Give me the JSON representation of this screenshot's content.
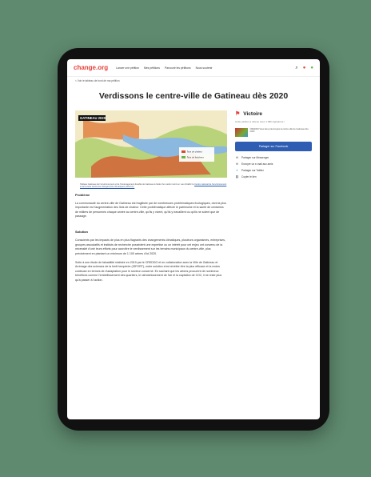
{
  "header": {
    "logo": "change.org",
    "nav": [
      "Lancer une pétition",
      "Mes pétitions",
      "Parcourir les pétitions",
      "Nous soutenir"
    ],
    "icons": [
      "search-icon",
      "notifications-icon",
      "avatar-icon"
    ]
  },
  "breadcrumb": "< Voir le tableau de bord de ma pétition",
  "title": "Verdissons le centre-ville de Gatineau dès 2020",
  "map": {
    "label": "GATINEAU 2020",
    "legend": [
      "Îlots de chaleur",
      "Îlots de fraîcheur"
    ]
  },
  "caption": {
    "text": "Tableau Gatineau de l'environnement et de l'Aménagement durable de Gatineau à l'aide d'un cadre inscrit en vue d'établir le",
    "link": "Centre national de l'environnement et de la lutte contre les changements climatiques (CNLCC)."
  },
  "sections": [
    {
      "heading": "Problème",
      "paragraphs": [
        "La communauté du centre-ville de Gatineau est fragilisée par de nombreuses problématiques écologiques, dont la plus importante est l'augmentation des îlots de chaleur. Cette problématique affecte le patrimoine et la santé de centaines de milliers de personnes chaque année au centre-ville, qu'ils y vivent, qu'ils y travaillent ou qu'ils ne soient que de passage."
      ]
    },
    {
      "heading": "Solution",
      "paragraphs": [
        "Conscients par les impacts de plus en plus flagrants des changements climatiques, plusieurs organismes, entreprises, groupes associatifs et instituts de recherche possèdent une expertise ou un intérêt pour cet enjeu ont convenu de la nécessité d'unir leurs efforts pour accroître le verdissement sur les terrains municipaux du centre-ville, plus précisément en plantant un minimum de 1 100 arbres d'ici 2020.",
        "Suite à une étude de faisabilité réalisée en 2019 par le CREDDO et en collaboration avec la Ville de Gatineau et Arrimage des sciences de la forêt tempérée (ISFORT), notre solution s'est révélée être la plus efficace et la moins coûteuse en termes de d'adaptation pour le secteur concerné. En sachant que les arbres procurent de nombreux bénéfices comme l'embellissement des quartiers, le rafraîchissement de l'air et la captation de CO2, il ne reste plus qu'à passer à l'action."
      ]
    }
  ],
  "sidebar": {
    "victory_label": "Victoire",
    "victory_text": "Cette pétition a obtenu avec 1 080 signatures !",
    "share_text": "CREDDO Vous êtes préoccupés la centre-ville de Gatineau dès 2020",
    "facebook_button": "Partager sur Facebook",
    "links": [
      {
        "icon": "messenger-icon",
        "label": "Partager sur Messenger"
      },
      {
        "icon": "email-icon",
        "label": "Envoyer un e-mail aux amis"
      },
      {
        "icon": "twitter-icon",
        "label": "Partager sur Twitter"
      },
      {
        "icon": "link-icon",
        "label": "Copier le lien"
      }
    ]
  },
  "colors": {
    "background": "#5f8a6f",
    "brand": "#e8403a",
    "facebook": "#2f5db3"
  }
}
